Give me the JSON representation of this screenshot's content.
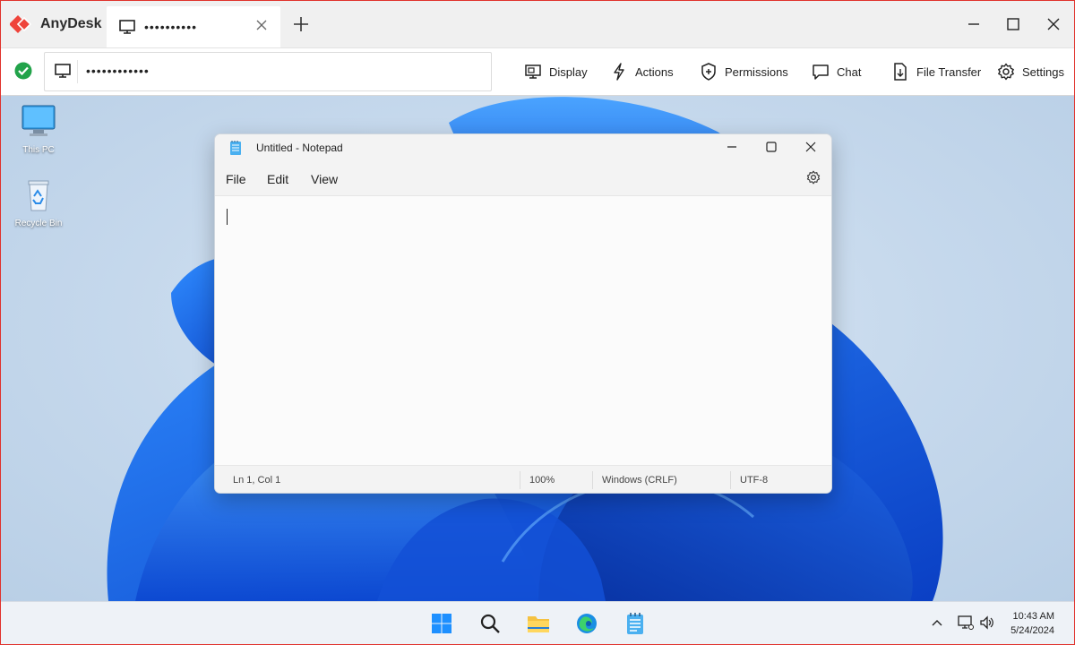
{
  "app": {
    "name": "AnyDesk",
    "brand_color": "#ef443b"
  },
  "tab": {
    "title": "••••••••••"
  },
  "toolbar": {
    "address": "••••••••••••",
    "display": "Display",
    "actions": "Actions",
    "permissions": "Permissions",
    "chat": "Chat",
    "file_transfer": "File Transfer",
    "settings": "Settings"
  },
  "desktop": {
    "icons": [
      {
        "label": "This PC",
        "icon": "this-pc-icon"
      },
      {
        "label": "Recycle Bin",
        "icon": "recycle-bin-icon"
      }
    ]
  },
  "notepad": {
    "title": "Untitled - Notepad",
    "menu": [
      "File",
      "Edit",
      "View"
    ],
    "status": {
      "position": "Ln 1, Col 1",
      "zoom": "100%",
      "line_ending": "Windows (CRLF)",
      "encoding": "UTF-8"
    }
  },
  "taskbar": {
    "apps": [
      "start-icon",
      "search-icon",
      "file-explorer-icon",
      "edge-icon",
      "notepad-icon"
    ],
    "time": "10:43 AM",
    "date": "5/24/2024"
  }
}
